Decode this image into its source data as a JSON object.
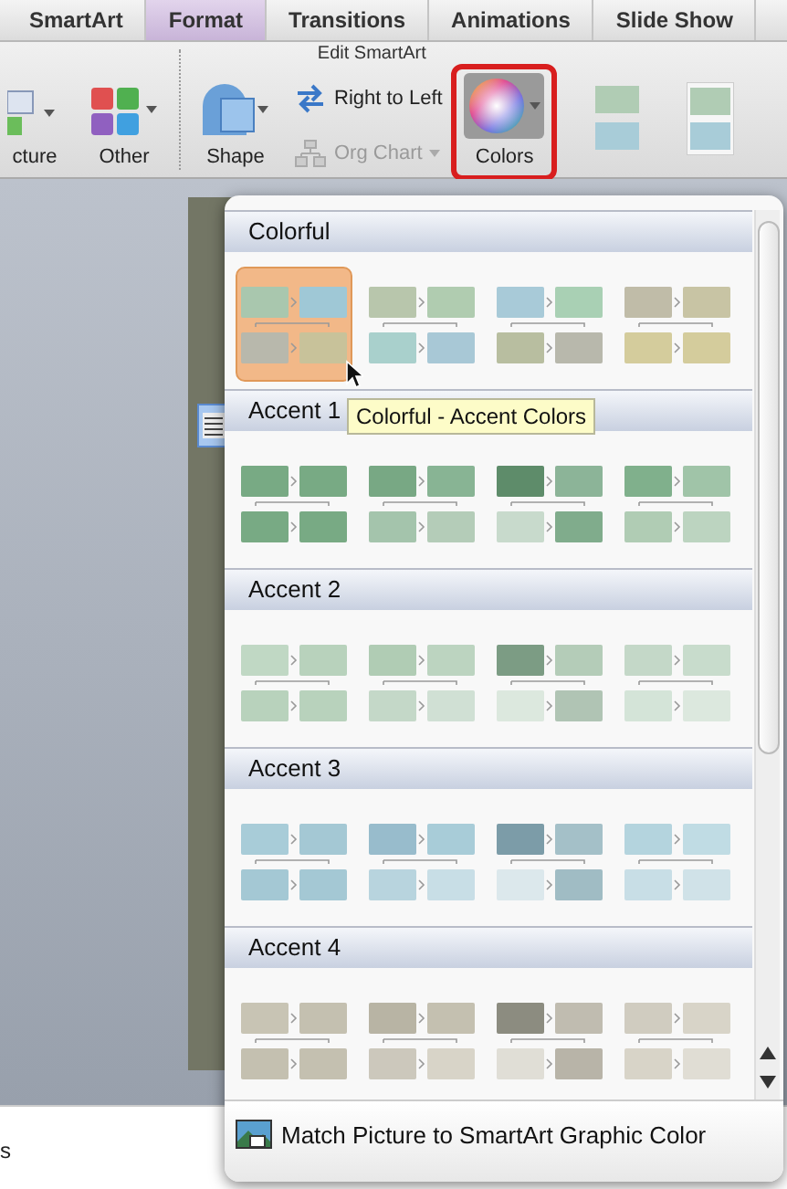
{
  "tabs": [
    {
      "label": "SmartArt",
      "selected": false
    },
    {
      "label": "Format",
      "selected": true
    },
    {
      "label": "Transitions",
      "selected": false
    },
    {
      "label": "Animations",
      "selected": false
    },
    {
      "label": "Slide Show",
      "selected": false
    }
  ],
  "ribbon": {
    "group_title": "Edit SmartArt",
    "items": [
      {
        "label": "cture",
        "kind": "big",
        "disabled": false,
        "selected": false
      },
      {
        "label": "Other",
        "kind": "big",
        "disabled": false,
        "selected": false
      },
      {
        "label": "Shape",
        "kind": "big",
        "disabled": false,
        "selected": false
      },
      {
        "label": "Right to Left",
        "kind": "small",
        "disabled": false,
        "selected": false
      },
      {
        "label": "Org Chart",
        "kind": "small",
        "disabled": true,
        "selected": false
      },
      {
        "label": "Colors",
        "kind": "big",
        "disabled": false,
        "selected": true
      }
    ]
  },
  "status_text": "s",
  "colors_menu": {
    "sections": [
      {
        "title": "Colorful",
        "swatches": [
          {
            "selected": true,
            "tiles": [
              {
                "color": "#a9c7ae"
              },
              {
                "color": "#9fc8d6"
              },
              {
                "color": "#b8b8ac"
              },
              {
                "color": "#c8c29a"
              }
            ]
          },
          {
            "selected": false,
            "tiles": [
              {
                "color": "#b8c6ac"
              },
              {
                "color": "#b0ccb0"
              },
              {
                "color": "#a9d0cc"
              },
              {
                "color": "#a8c8d6"
              }
            ]
          },
          {
            "selected": false,
            "tiles": [
              {
                "color": "#a8cad8"
              },
              {
                "color": "#a9d0b4"
              },
              {
                "color": "#b8bea0"
              },
              {
                "color": "#b8b8ac"
              }
            ]
          },
          {
            "selected": false,
            "tiles": [
              {
                "color": "#c0bca8"
              },
              {
                "color": "#c8c4a4"
              },
              {
                "color": "#d4cc9c"
              },
              {
                "color": "#d4cc9c"
              }
            ]
          }
        ]
      },
      {
        "title": "Accent 1",
        "swatches": [
          {
            "selected": false,
            "tiles": [
              {
                "color": "#78aa84"
              },
              {
                "color": "#78aa84"
              },
              {
                "color": "#78aa84"
              },
              {
                "color": "#78aa84"
              }
            ]
          },
          {
            "selected": false,
            "tiles": [
              {
                "color": "#78a884"
              },
              {
                "color": "#88b494"
              },
              {
                "color": "#a4c4ac"
              },
              {
                "color": "#b4ccb8"
              }
            ]
          },
          {
            "selected": false,
            "tiles": [
              {
                "color": "#5e8c6a"
              },
              {
                "color": "#8cb498"
              },
              {
                "color": "#c8dacc"
              },
              {
                "color": "#80ac8c"
              }
            ]
          },
          {
            "selected": false,
            "tiles": [
              {
                "color": "#80b08c"
              },
              {
                "color": "#a0c4a8"
              },
              {
                "color": "#b0ccb4"
              },
              {
                "color": "#bcd4c0"
              }
            ]
          }
        ]
      },
      {
        "title": "Accent 2",
        "swatches": [
          {
            "selected": false,
            "tiles": [
              {
                "color": "#c0d8c4"
              },
              {
                "color": "#b8d2bc"
              },
              {
                "color": "#b8d2bc"
              },
              {
                "color": "#b8d2bc"
              }
            ]
          },
          {
            "selected": false,
            "tiles": [
              {
                "color": "#b0ccb4"
              },
              {
                "color": "#bcd4c0"
              },
              {
                "color": "#c4d8c8"
              },
              {
                "color": "#d0e0d4"
              }
            ]
          },
          {
            "selected": false,
            "tiles": [
              {
                "color": "#7c9c84"
              },
              {
                "color": "#b4ccb8"
              },
              {
                "color": "#dce8de"
              },
              {
                "color": "#b0c4b4"
              }
            ]
          },
          {
            "selected": false,
            "tiles": [
              {
                "color": "#c4d8c8"
              },
              {
                "color": "#c8dccc"
              },
              {
                "color": "#d4e4d8"
              },
              {
                "color": "#dce8de"
              }
            ]
          }
        ]
      },
      {
        "title": "Accent 3",
        "swatches": [
          {
            "selected": false,
            "tiles": [
              {
                "color": "#a8ccd8"
              },
              {
                "color": "#a4c8d4"
              },
              {
                "color": "#a4c8d4"
              },
              {
                "color": "#a4c8d4"
              }
            ]
          },
          {
            "selected": false,
            "tiles": [
              {
                "color": "#98bccc"
              },
              {
                "color": "#a8ccd8"
              },
              {
                "color": "#b8d4de"
              },
              {
                "color": "#c8dee6"
              }
            ]
          },
          {
            "selected": false,
            "tiles": [
              {
                "color": "#7c9ca8"
              },
              {
                "color": "#a4c0c8"
              },
              {
                "color": "#dce8ec"
              },
              {
                "color": "#a0bcc4"
              }
            ]
          },
          {
            "selected": false,
            "tiles": [
              {
                "color": "#b4d4de"
              },
              {
                "color": "#c0dce4"
              },
              {
                "color": "#c8dee6"
              },
              {
                "color": "#d0e2e8"
              }
            ]
          }
        ]
      },
      {
        "title": "Accent 4",
        "swatches": [
          {
            "selected": false,
            "tiles": [
              {
                "color": "#c8c4b4"
              },
              {
                "color": "#c4c0b0"
              },
              {
                "color": "#c4c0b0"
              },
              {
                "color": "#c4c0b0"
              }
            ]
          },
          {
            "selected": false,
            "tiles": [
              {
                "color": "#b8b4a4"
              },
              {
                "color": "#c4c0b0"
              },
              {
                "color": "#ccc8bc"
              },
              {
                "color": "#d8d4c8"
              }
            ]
          },
          {
            "selected": false,
            "tiles": [
              {
                "color": "#8c8c80"
              },
              {
                "color": "#c0bcb0"
              },
              {
                "color": "#e0ded6"
              },
              {
                "color": "#b8b4a8"
              }
            ]
          },
          {
            "selected": false,
            "tiles": [
              {
                "color": "#d0ccc0"
              },
              {
                "color": "#d8d4c8"
              },
              {
                "color": "#d8d4c8"
              },
              {
                "color": "#e0ddd4"
              }
            ]
          }
        ]
      }
    ],
    "tooltip": "Colorful - Accent Colors",
    "footer": "Match Picture to SmartArt Graphic Color"
  }
}
